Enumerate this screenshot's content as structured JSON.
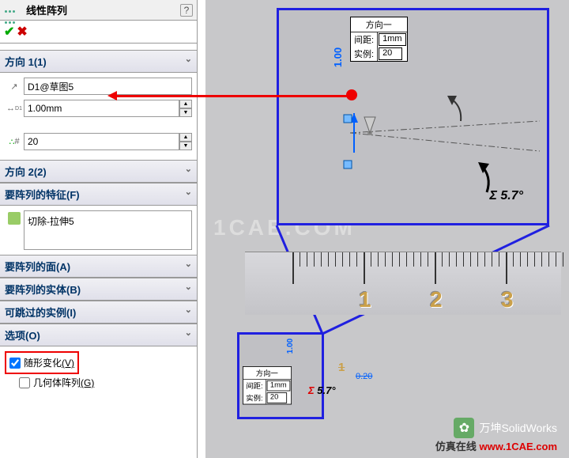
{
  "panel": {
    "title": "线性阵列",
    "help": "?",
    "dir1": {
      "header": "方向 1(1)",
      "ref": "D1@草图5",
      "spacing": "1.00mm",
      "count": "20"
    },
    "dir2": {
      "header": "方向 2(2)"
    },
    "features": {
      "header": "要阵列的特征(F)",
      "item": "切除-拉伸5"
    },
    "faces": {
      "header": "要阵列的面(A)"
    },
    "bodies": {
      "header": "要阵列的实体(B)"
    },
    "skip": {
      "header": "可跳过的实例(I)"
    },
    "options": {
      "header": "选项(O)",
      "varySketch_pre": "随形变化",
      "varySketch_u": "(V)",
      "geomPattern_pre": "几何体阵列",
      "geomPattern_u": "(G)"
    }
  },
  "cad": {
    "labelBox": {
      "title": "方向一",
      "spacingLabel": "间距:",
      "spacingValue": "1mm",
      "countLabel": "实例:",
      "countValue": "20"
    },
    "dimValue": "1.00",
    "angle": "Σ 5.7°"
  },
  "ruler": {
    "numbers": [
      "1",
      "2",
      "3"
    ],
    "smallDim1": "1.00",
    "smallDim2": "0.20",
    "angle": "Σ 5.7°"
  },
  "watermark": "万坤SolidWorks",
  "site_pre": "仿真在线 ",
  "site_url": "www.1CAE.com",
  "bg_wm": "1CAE.COM"
}
